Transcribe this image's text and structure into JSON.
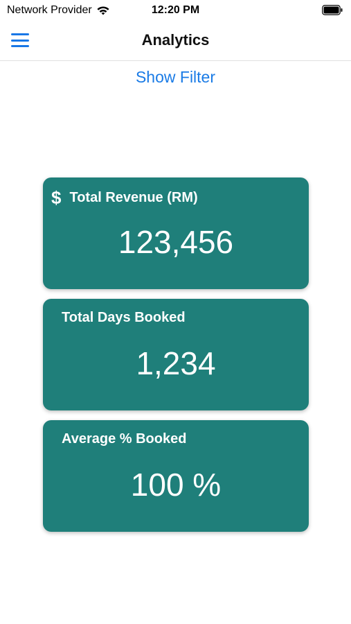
{
  "status_bar": {
    "carrier": "Network Provider",
    "time": "12:20 PM",
    "wifi_icon": "wifi-icon",
    "battery_icon": "battery-icon"
  },
  "nav": {
    "title": "Analytics",
    "menu_icon": "hamburger-menu-icon"
  },
  "filter": {
    "label": "Show Filter"
  },
  "cards": [
    {
      "title": "Total Revenue (RM)",
      "value": "123,456",
      "icon": "dollar-icon"
    },
    {
      "title": "Total Days Booked",
      "value": "1,234"
    },
    {
      "title": "Average % Booked",
      "value": "100 %"
    }
  ],
  "colors": {
    "card_background": "#1f7f7a",
    "accent": "#1a7be6"
  }
}
